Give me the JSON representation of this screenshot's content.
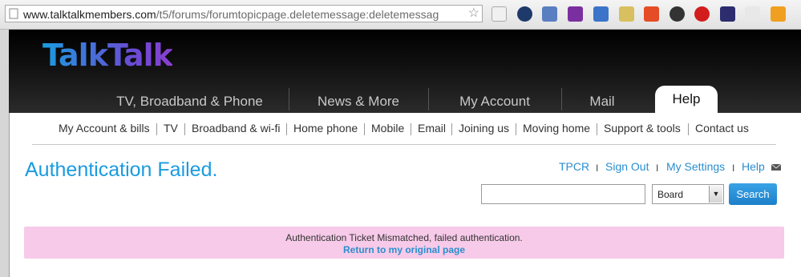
{
  "browser": {
    "url_host": "www.talktalkmembers.com",
    "url_path": "/t5/forums/forumtopicpage.deletemessage:deletemessag",
    "extensions": [
      "page-icon",
      "circle-icon",
      "network-icon",
      "n-icon",
      "hd-icon",
      "pencil-icon",
      "html5-icon",
      "gear-icon",
      "stop-icon",
      "shield-icon",
      "css-icon",
      "css3-icon"
    ]
  },
  "site": {
    "logo": "TalkTalk",
    "nav": [
      "TV, Broadband & Phone",
      "News & More",
      "My Account",
      "Mail",
      "Help"
    ],
    "active_nav": "Help",
    "subnav": [
      "My Account & bills",
      "TV",
      "Broadband & wi-fi",
      "Home phone",
      "Mobile",
      "Email",
      "Joining us",
      "Moving home",
      "Support & tools",
      "Contact us"
    ]
  },
  "page": {
    "title": "Authentication Failed.",
    "user_links": [
      "TPCR",
      "Sign Out",
      "My Settings",
      "Help"
    ],
    "search": {
      "value": "",
      "scope": "Board",
      "button": "Search"
    },
    "alert": {
      "message": "Authentication Ticket Mismatched, failed authentication.",
      "link": "Return to my original page"
    }
  }
}
